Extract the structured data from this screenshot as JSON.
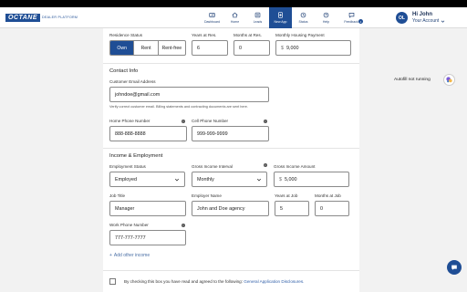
{
  "brand": {
    "logo": "OCTANE",
    "subtitle": "DEALER PLATFORM"
  },
  "nav": [
    {
      "label": "Dashboard",
      "icon": "dashboard-icon"
    },
    {
      "label": "Home",
      "icon": "home-icon"
    },
    {
      "label": "Leads",
      "icon": "leads-icon"
    },
    {
      "label": "New App",
      "icon": "new-app-icon",
      "active": true
    },
    {
      "label": "Status",
      "icon": "status-icon"
    },
    {
      "label": "Help",
      "icon": "help-icon"
    },
    {
      "label": "Feedback",
      "icon": "feedback-icon",
      "badge": "1"
    }
  ],
  "user": {
    "initials": "OL",
    "greeting": "Hi John",
    "account_label": "Your Account"
  },
  "residence": {
    "status_label": "Residence Status",
    "options": [
      "Own",
      "Rent",
      "Rent-free"
    ],
    "selected": "Own",
    "years_label": "Years at Res.",
    "years_value": "6",
    "months_label": "Months at Res.",
    "months_value": "0",
    "payment_label": "Monthly Housing Payment",
    "payment_prefix": "$",
    "payment_value": "9,000"
  },
  "contact": {
    "title": "Contact Info",
    "email_label": "Customer Email Address",
    "email_value": "johndoe@gmail.com",
    "email_hint": "Verify correct customer email. Billing statements and contracting documents are sent here.",
    "home_phone_label": "Home Phone Number",
    "home_phone_value": "888-888-8888",
    "cell_phone_label": "Cell Phone Number",
    "cell_phone_value": "999-999-9999"
  },
  "income": {
    "title": "Income & Employment",
    "employment_status_label": "Employment Status",
    "employment_status_value": "Employed",
    "interval_label": "Gross Income Interval",
    "interval_value": "Monthly",
    "amount_label": "Gross Income Amount",
    "amount_prefix": "$",
    "amount_value": "5,000",
    "job_title_label": "Job Title",
    "job_title_value": "Manager",
    "employer_label": "Employer Name",
    "employer_value": "John and Doe agency",
    "years_job_label": "Years at Job",
    "years_job_value": "5",
    "months_job_label": "Months at Job",
    "months_job_value": "0",
    "work_phone_label": "Work Phone Number",
    "work_phone_value": "777-777-7777",
    "add_other_label": "Add other income"
  },
  "disclosure": {
    "text": "By checking this box you have read and agreed to the following:",
    "link": "General Application Disclosures."
  },
  "widgets": {
    "autofill_status": "Autofill not running"
  },
  "colors": {
    "brand": "#1f4e95",
    "background": "#f2f2f2",
    "link": "#2f5ea8"
  }
}
